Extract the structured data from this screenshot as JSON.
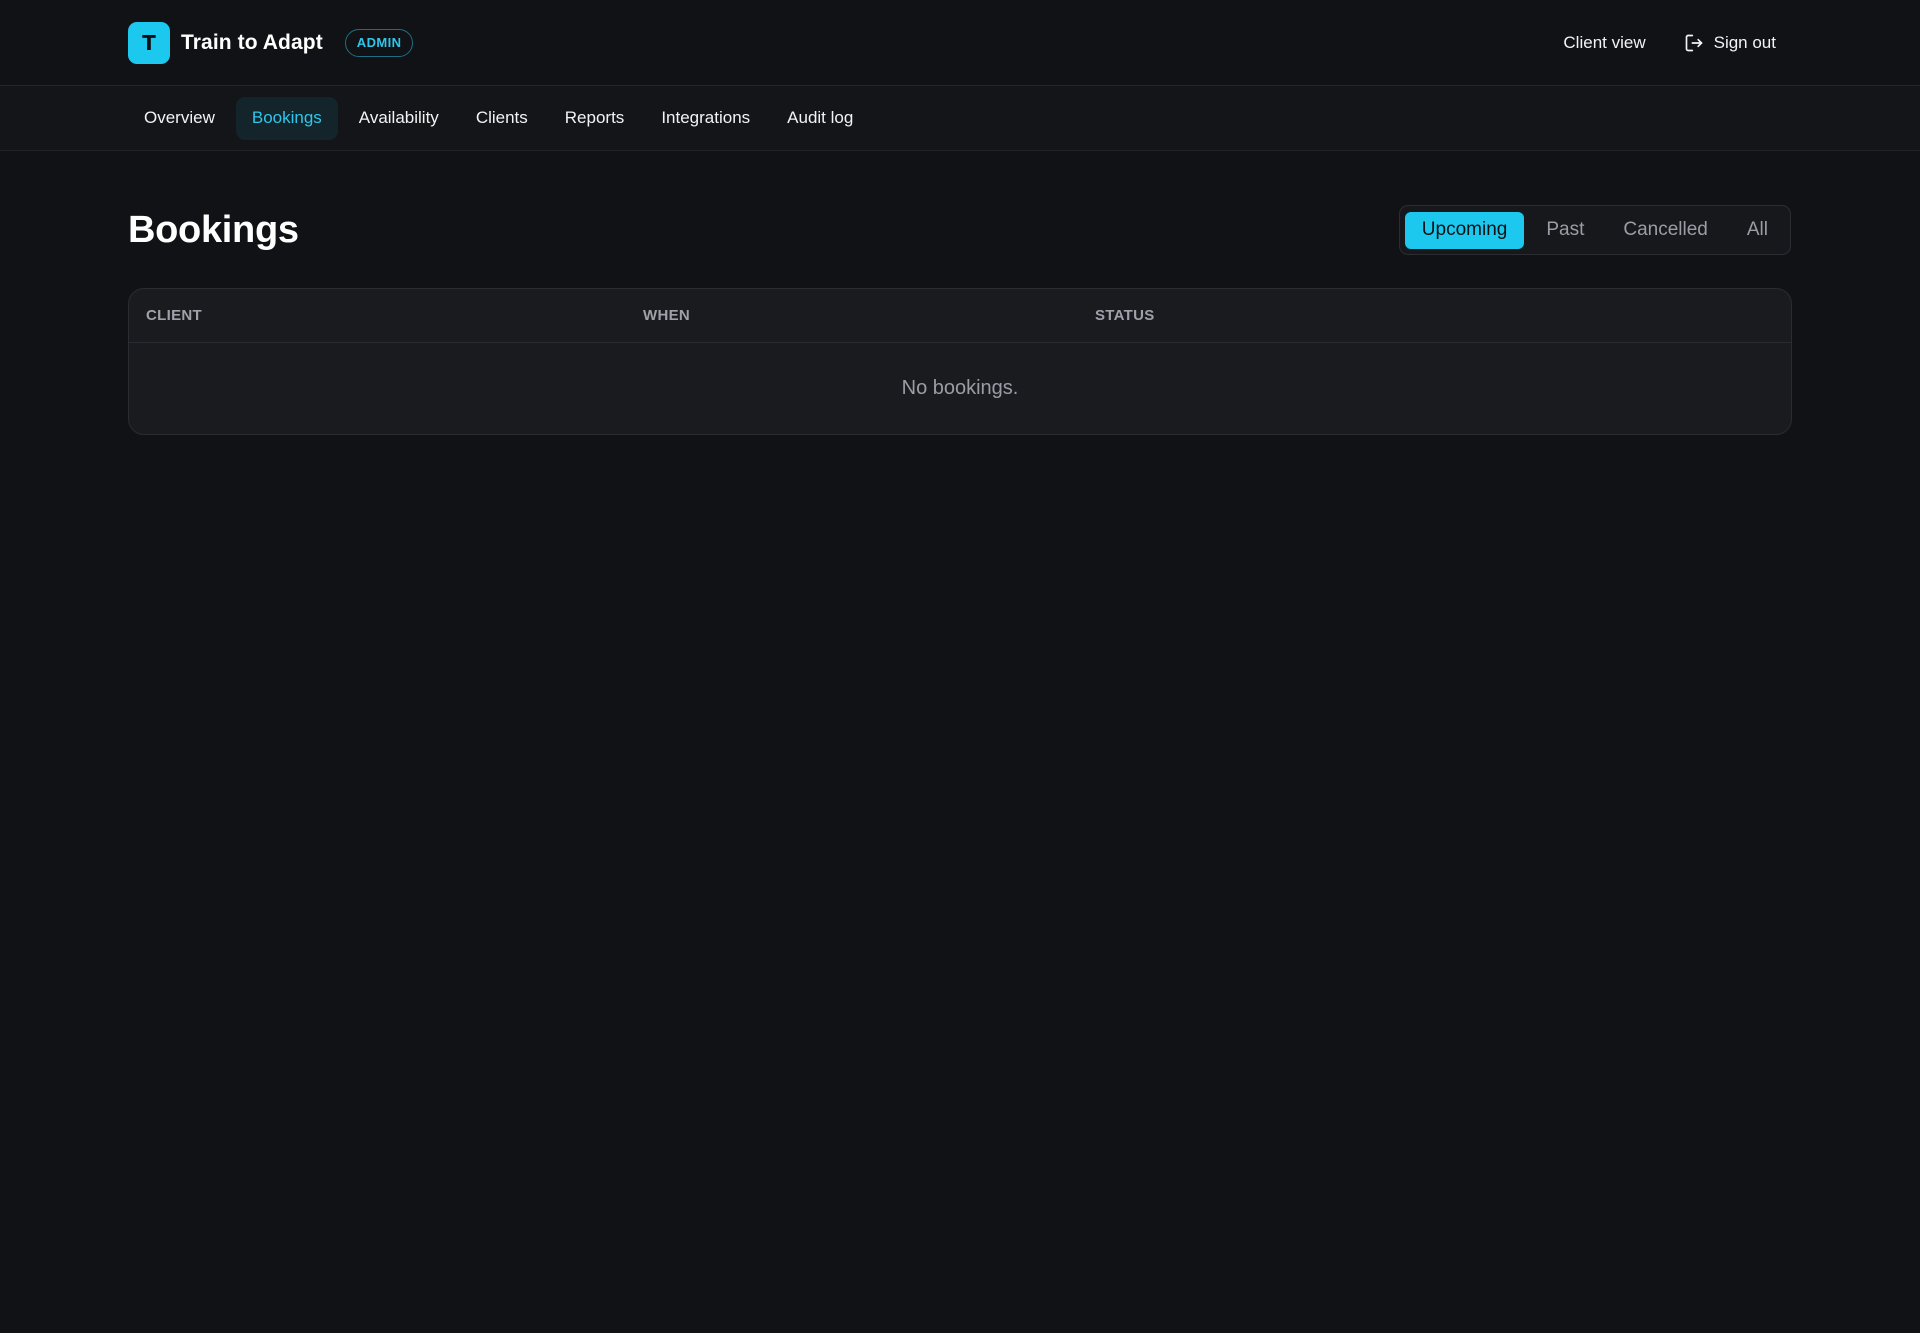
{
  "header": {
    "logo_letter": "T",
    "app_name": "Train to Adapt",
    "role_badge": "ADMIN",
    "client_view_label": "Client view",
    "sign_out_label": "Sign out",
    "sign_out_icon": "sign-out-icon"
  },
  "nav": {
    "items": [
      {
        "label": "Overview"
      },
      {
        "label": "Bookings",
        "active": true
      },
      {
        "label": "Availability"
      },
      {
        "label": "Clients"
      },
      {
        "label": "Reports"
      },
      {
        "label": "Integrations"
      },
      {
        "label": "Audit log"
      }
    ]
  },
  "page": {
    "title": "Bookings",
    "filters": [
      {
        "label": "Upcoming",
        "active": true
      },
      {
        "label": "Past"
      },
      {
        "label": "Cancelled"
      },
      {
        "label": "All"
      }
    ]
  },
  "table": {
    "columns": [
      "CLIENT",
      "WHEN",
      "STATUS"
    ],
    "empty_message": "No bookings."
  },
  "colors": {
    "background": "#111215",
    "accent": "#1cc8ee",
    "card": "#1a1b1e",
    "muted_text": "#9a9da6"
  }
}
